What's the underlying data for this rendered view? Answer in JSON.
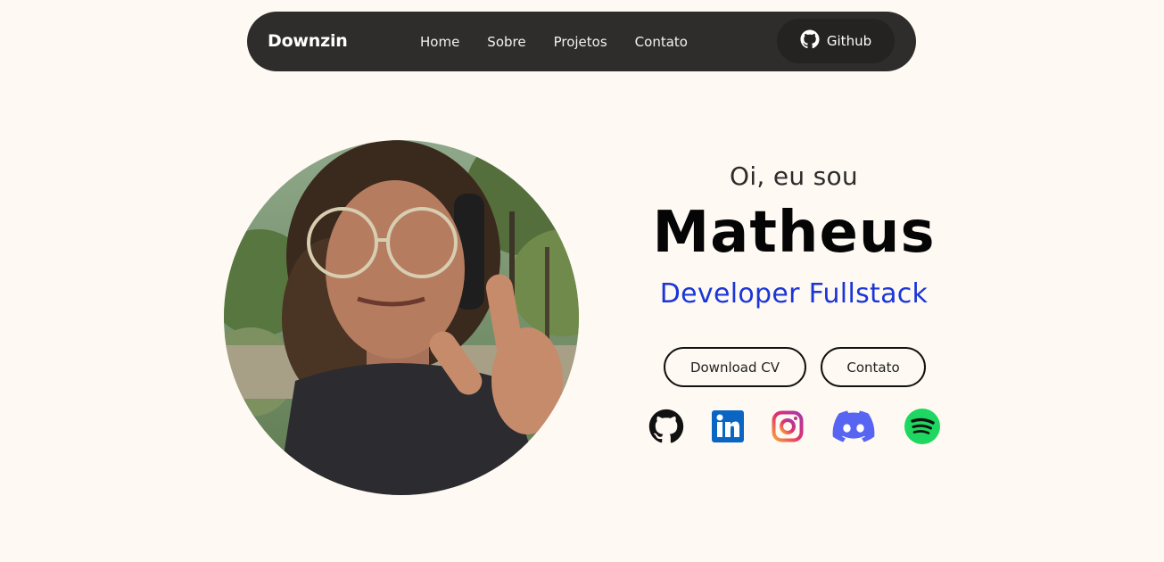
{
  "navbar": {
    "brand": "Downzin",
    "links": [
      "Home",
      "Sobre",
      "Projetos",
      "Contato"
    ],
    "github_label": "Github"
  },
  "hero": {
    "greeting": "Oi, eu sou",
    "name": "Matheus",
    "role": "Developer Fullstack",
    "download_cv_label": "Download CV",
    "contact_label": "Contato"
  },
  "social_icons": [
    "github-icon",
    "linkedin-icon",
    "instagram-icon",
    "discord-icon",
    "spotify-icon"
  ],
  "colors": {
    "page_background": "#fef9f2",
    "navbar_background": "#2f2d2b",
    "github_button_background": "#242322",
    "role_text": "#1a36d6",
    "linkedin": "#0a66c2",
    "discord": "#5865f2",
    "spotify": "#1ed760"
  }
}
